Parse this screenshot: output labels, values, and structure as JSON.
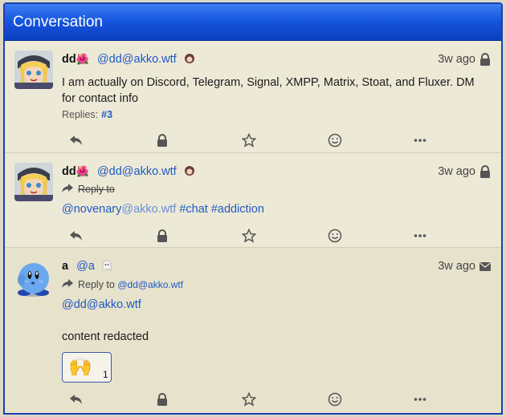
{
  "panel": {
    "title": "Conversation"
  },
  "statuses": [
    {
      "name": "dd",
      "name_emoji": "🌺",
      "acct": "@dd@akko.wtf",
      "time": "3w ago",
      "visibility": "lock-icon",
      "content": "I am actually on Discord, Telegram, Signal, XMPP, Matrix, Stoat, and Fluxer. DM for contact info",
      "replies_label": "Replies:",
      "replies_link": "#3"
    },
    {
      "name": "dd",
      "name_emoji": "🌺",
      "acct": "@dd@akko.wtf",
      "time": "3w ago",
      "visibility": "lock-icon",
      "reply_to_label": "Reply to",
      "mention_user": "@novenary",
      "mention_host": "@akko.wtf",
      "tag1": "#chat",
      "tag2": "#addiction"
    },
    {
      "name": "a",
      "acct": "@a",
      "time": "3w ago",
      "visibility": "envelope-icon",
      "reply_to_label": "Reply to",
      "reply_to_who": "@dd@akko.wtf",
      "mention": "@dd@akko.wtf",
      "content": "content redacted",
      "reaction_emoji": "🙌",
      "reaction_count": "1"
    }
  ],
  "colors": {
    "header": "#1656e0",
    "link": "#1f59c4",
    "panel_bg": "#ede9d7"
  }
}
